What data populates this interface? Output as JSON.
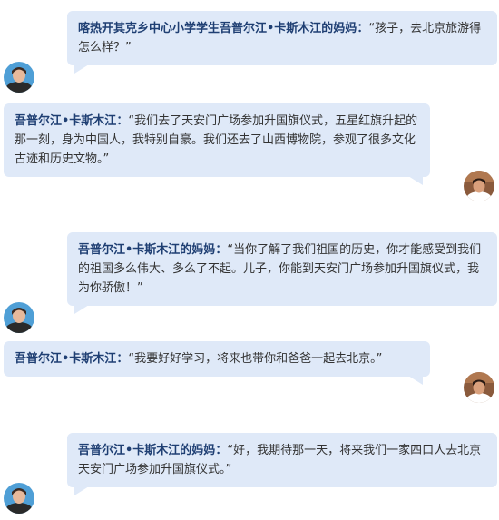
{
  "messages": [
    {
      "speaker": "喀热开其克乡中心小学学生吾普尔江•卡斯木江的妈妈",
      "colon": "：",
      "text": "“孩子，去北京旅游得怎么样？”",
      "avatar": "mother-avatar"
    },
    {
      "speaker": "吾普尔江•卡斯木江",
      "colon": "：",
      "text": "“我们去了天安门广场参加升国旗仪式，五星红旗升起的那一刻，身为中国人，我特别自豪。我们还去了山西博物院，参观了很多文化古迹和历史文物。”",
      "avatar": "boy-avatar"
    },
    {
      "speaker": "吾普尔江•卡斯木江的妈妈",
      "colon": "：",
      "text": "“当你了解了我们祖国的历史，你才能感受到我们的祖国多么伟大、多么了不起。儿子，你能到天安门广场参加升国旗仪式，我为你骄傲！”",
      "avatar": "mother-avatar"
    },
    {
      "speaker": "吾普尔江•卡斯木江",
      "colon": "：",
      "text": "“我要好好学习，将来也带你和爸爸一起去北京。”",
      "avatar": "boy-avatar"
    },
    {
      "speaker": "吾普尔江•卡斯木江的妈妈",
      "colon": "：",
      "text": "“好，我期待那一天，将来我们一家四口人去北京天安门广场参加升国旗仪式。”",
      "avatar": "mother-avatar"
    }
  ],
  "colors": {
    "bubble_bg": "#dfe9f8",
    "speaker_text": "#1f3f73",
    "body_text": "#333333"
  }
}
